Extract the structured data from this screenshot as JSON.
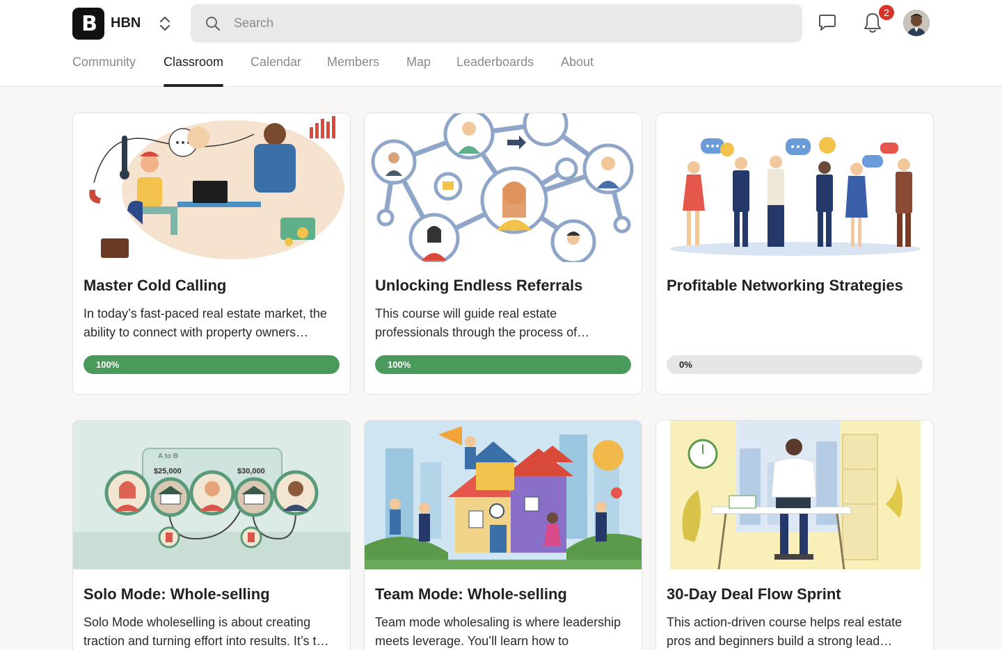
{
  "header": {
    "brand": "HBN",
    "logo_text": "B",
    "search_placeholder": "Search",
    "notifications_count": "2"
  },
  "tabs": [
    {
      "label": "Community"
    },
    {
      "label": "Classroom",
      "active": true
    },
    {
      "label": "Calendar"
    },
    {
      "label": "Members"
    },
    {
      "label": "Map"
    },
    {
      "label": "Leaderboards"
    },
    {
      "label": "About"
    }
  ],
  "courses": [
    {
      "title": "Master Cold Calling",
      "description": "In today’s fast-paced real estate market, the ability to connect with property owners…",
      "progress_label": "100%",
      "progress": 1.0
    },
    {
      "title": "Unlocking Endless Referrals",
      "description": "This course will guide real estate professionals through the process of…",
      "progress_label": "100%",
      "progress": 1.0
    },
    {
      "title": "Profitable Networking Strategies",
      "description": "",
      "progress_label": "0%",
      "progress": 0.0
    },
    {
      "title": "Solo Mode: Whole-selling",
      "description": "Solo Mode wholeselling is about creating traction and turning effort into results. It’s t…"
    },
    {
      "title": "Team Mode: Whole-selling",
      "description": "Team mode wholesaling is where leadership meets leverage. You’ll learn how to delegate…"
    },
    {
      "title": "30-Day Deal Flow Sprint",
      "description": "This action-driven course helps real estate pros and beginners build a strong lead…"
    }
  ],
  "image_text": {
    "solo_a_to_b": "A to B",
    "solo_price_1": "$25,000",
    "solo_price_2": "$30,000"
  },
  "colors": {
    "progress_complete": "#4a9a5c",
    "progress_track": "#e6e6e6",
    "badge": "#d9342b"
  }
}
